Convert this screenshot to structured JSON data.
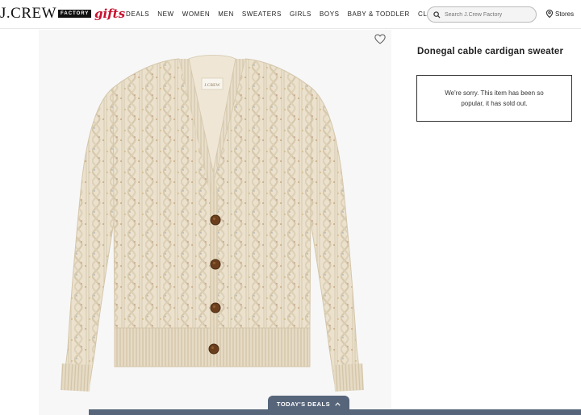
{
  "header": {
    "logo_main": "J.CREW",
    "logo_tag": "FACTORY",
    "gifts_label": "gifts",
    "nav": [
      "DEALS",
      "NEW",
      "WOMEN",
      "MEN",
      "SWEATERS",
      "GIRLS",
      "BOYS",
      "BABY & TODDLER",
      "CLEARANCE"
    ],
    "search_placeholder": "Search J.Crew Factory",
    "stores_label": "Stores"
  },
  "product": {
    "title": "Donegal cable cardigan sweater",
    "image_label": "J.CREW",
    "sold_out_message": "We're sorry. This item has been so popular, it has sold out.",
    "colors": {
      "sweater": "#eadfcb",
      "button": "#6b3f1e",
      "accent": "#c8102e"
    }
  },
  "deals": {
    "label": "TODAY'S DEALS"
  }
}
